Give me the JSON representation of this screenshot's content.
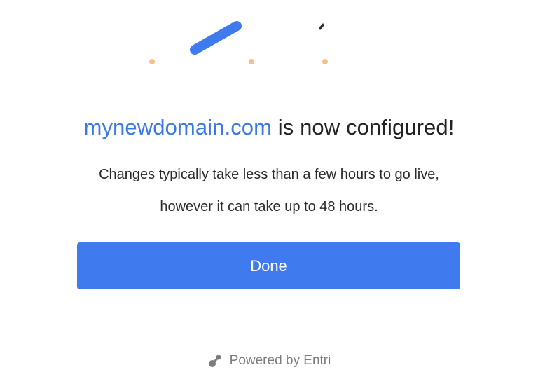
{
  "confirmation": {
    "domain": "mynewdomain.com",
    "title_suffix": " is now configured!",
    "message": "Changes typically take less than a few hours to go live, however it can take up to 48 hours."
  },
  "actions": {
    "done_label": "Done"
  },
  "footer": {
    "powered_by": "Powered by Entri",
    "logo_icon": "entri-logo-icon"
  },
  "colors": {
    "accent": "#3f7aef",
    "domain_text": "#3b78e7",
    "confetti_dot": "#f5c08a",
    "confetti_dark": "#3a2a22",
    "muted_text": "#7c7c7c"
  }
}
